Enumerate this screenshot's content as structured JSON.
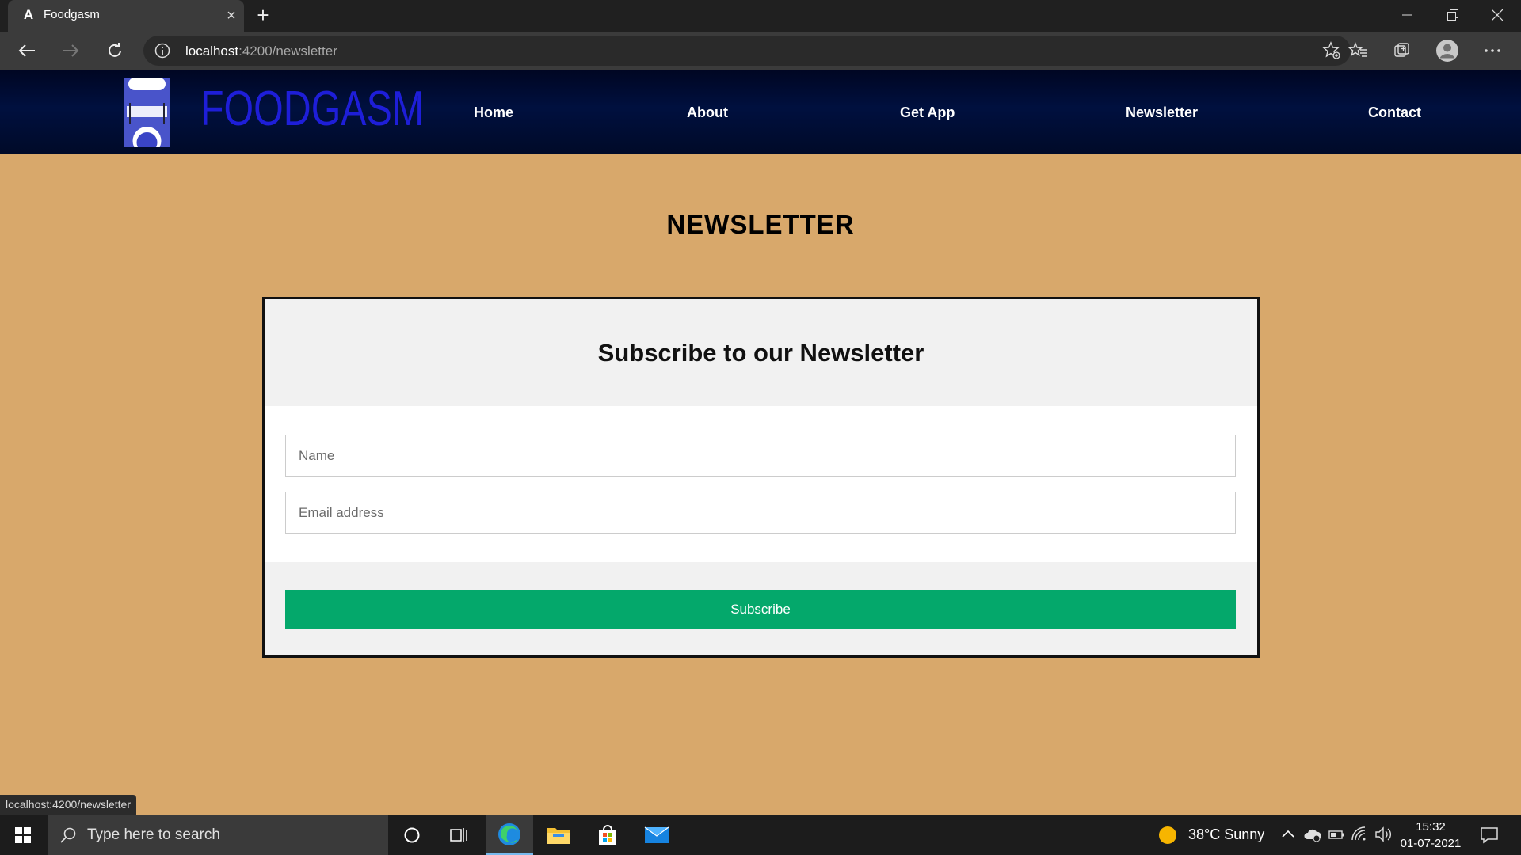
{
  "browser": {
    "tab_title": "Foodgasm",
    "tab_favicon": "A",
    "url_host": "localhost",
    "url_path": ":4200/newsletter",
    "status_url": "localhost:4200/newsletter"
  },
  "site": {
    "brand": "FOODGASM",
    "nav": [
      {
        "label": "Home"
      },
      {
        "label": "About"
      },
      {
        "label": "Get App"
      },
      {
        "label": "Newsletter"
      },
      {
        "label": "Contact"
      }
    ]
  },
  "page": {
    "title": "NEWSLETTER",
    "card_heading": "Subscribe to our Newsletter",
    "name_placeholder": "Name",
    "email_placeholder": "Email address",
    "subscribe_label": "Subscribe"
  },
  "taskbar": {
    "search_placeholder": "Type here to search",
    "weather": "38°C  Sunny",
    "time": "15:32",
    "date": "01-07-2021"
  },
  "colors": {
    "page_bg": "#d8a86b",
    "brand": "#1e1ed8",
    "subscribe": "#04a86b"
  }
}
